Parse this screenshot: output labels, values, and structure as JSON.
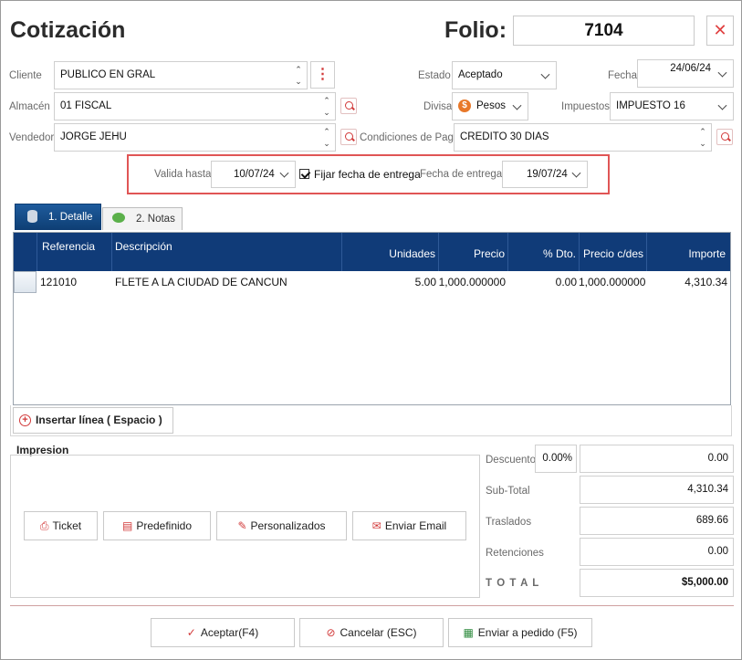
{
  "header": {
    "title": "Cotización",
    "folio_label": "Folio:",
    "folio_value": "7104",
    "close_glyph": "✕"
  },
  "form": {
    "cliente_label": "Cliente",
    "cliente_value": "PUBLICO EN GRAL",
    "almacen_label": "Almacén",
    "almacen_value": "01 FISCAL",
    "vendedor_label": "Vendedor",
    "vendedor_value": "JORGE JEHU",
    "estado_label": "Estado",
    "estado_value": "Aceptado",
    "divisa_label": "Divisa",
    "divisa_value": "Pesos",
    "condiciones_label": "Condiciones de Pago",
    "condiciones_value": "CREDITO 30 DIAS",
    "fecha_label": "Fecha",
    "fecha_value": "24/06/24",
    "impuestos_label": "Impuestos",
    "impuestos_value": "IMPUESTO 16"
  },
  "validity": {
    "valida_hasta_label": "Valida hasta",
    "valida_hasta_value": "10/07/24",
    "fijar_label": "Fijar fecha de entrega",
    "fijar_checked": true,
    "fecha_entrega_label": "Fecha de entrega",
    "fecha_entrega_value": "19/07/24"
  },
  "tabs": [
    {
      "label": "1. Detalle",
      "icon": "database-icon",
      "active": true
    },
    {
      "label": "2. Notas",
      "icon": "chat-icon",
      "active": false
    }
  ],
  "grid": {
    "columns": [
      "Referencia",
      "Descripción",
      "Unidades",
      "Precio",
      "% Dto.",
      "Precio c/des",
      "Importe"
    ],
    "rows": [
      [
        "121010",
        "FLETE A LA CIUDAD DE CANCUN",
        "5.00",
        "1,000.000000",
        "0.00",
        "1,000.000000",
        "4,310.34"
      ]
    ]
  },
  "insert_button": "Insertar línea ( Espacio )",
  "impresion": {
    "title": "Impresion",
    "buttons": [
      "Ticket",
      "Predefinido",
      "Personalizados",
      "Enviar Email"
    ]
  },
  "totals": {
    "descuento_label": "Descuento",
    "descuento_pct": "0.00%",
    "descuento_value": "0.00",
    "subtotal_label": "Sub-Total",
    "subtotal_value": "4,310.34",
    "traslados_label": "Traslados",
    "traslados_value": "689.66",
    "retenciones_label": "Retenciones",
    "retenciones_value": "0.00",
    "total_label": "T O T A L",
    "total_value": "$5,000.00"
  },
  "footer": {
    "accept": "Aceptar(F4)",
    "cancel": "Cancelar (ESC)",
    "send_order": "Enviar a pedido (F5)"
  },
  "colors": {
    "accent": "#d23a3a",
    "grid_header": "#103b78",
    "tab_active": "#1e5b9c",
    "highlight": "#e05555"
  }
}
